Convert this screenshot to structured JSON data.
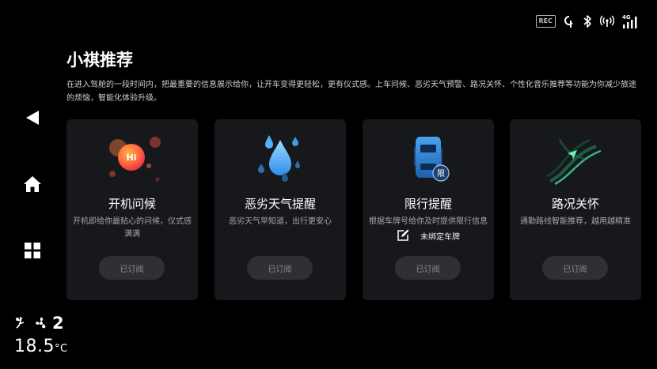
{
  "status_bar": {
    "rec_label": "REC",
    "network_label": "4G",
    "icons": [
      "rec-icon",
      "wireless-charging-icon",
      "bluetooth-icon",
      "wifi-hotspot-icon",
      "signal-icon"
    ]
  },
  "side_nav": {
    "items": [
      {
        "name": "back",
        "icon": "back-arrow-icon"
      },
      {
        "name": "home",
        "icon": "home-icon"
      },
      {
        "name": "apps",
        "icon": "apps-grid-icon"
      }
    ]
  },
  "climate": {
    "fan_level": "2",
    "temperature": "18.5",
    "temperature_unit": "°C"
  },
  "page": {
    "title": "小祺推荐",
    "description": "在进入驾舱的一段时间内，把最重要的信息展示给你，让开车变得更轻松，更有仪式感。上车问候、恶劣天气预警、路况关怀、个性化音乐推荐等功能为你减少旅途的烦恼，智能化体验升级。"
  },
  "cards": [
    {
      "title": "开机问候",
      "desc": "开机即给你最贴心的问候，仪式感满满",
      "button": "已订阅",
      "visual_label": "Hi",
      "icon": "greeting-bubbles-icon"
    },
    {
      "title": "恶劣天气提醒",
      "desc": "恶劣天气早知道，出行更安心",
      "button": "已订阅",
      "icon": "water-drops-icon"
    },
    {
      "title": "限行提醒",
      "desc": "根据车牌号给你及时提供限行信息",
      "button": "已订阅",
      "plate_text": "未绑定车牌",
      "visual_label": "限",
      "icon": "car-restriction-icon"
    },
    {
      "title": "路况关怀",
      "desc": "通勤路线智能推荐，越用越精准",
      "button": "已订阅",
      "icon": "road-navigation-icon"
    }
  ],
  "colors": {
    "background": "#000000",
    "card_bg": "#17181b",
    "button_bg": "#2e3035",
    "button_text": "#8b8d91",
    "accent_blue": "#2f8fe8",
    "accent_green": "#3fcf8e"
  }
}
